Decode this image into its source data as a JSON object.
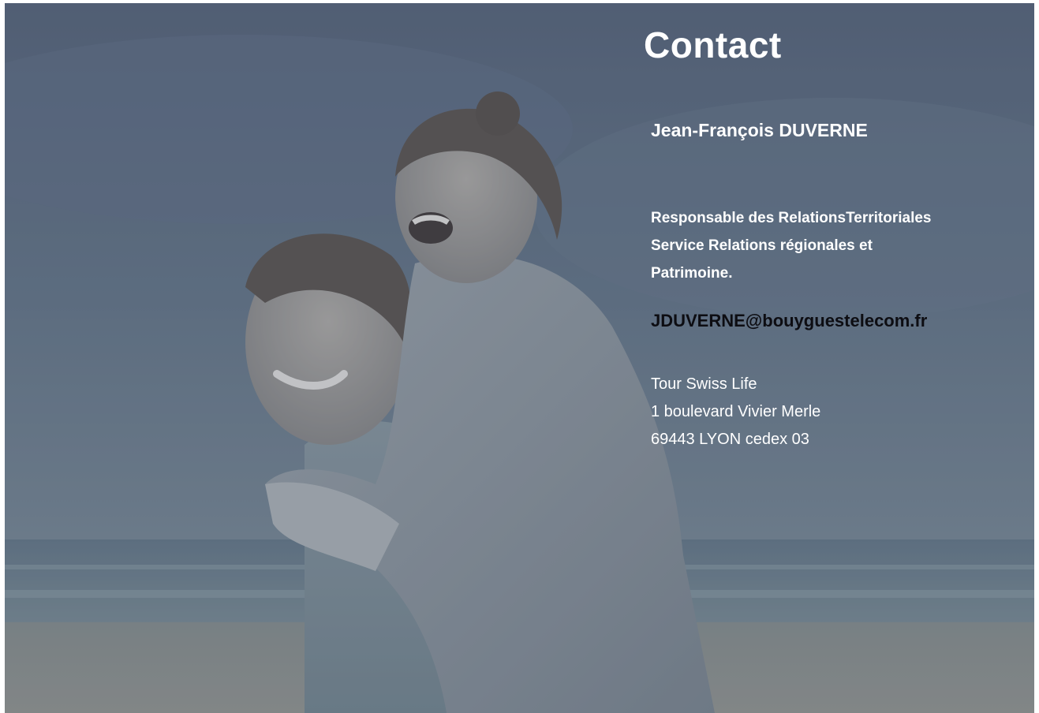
{
  "contact": {
    "title": "Contact",
    "name": "Jean-François DUVERNE",
    "role_lines": [
      "Responsable des RelationsTerritoriales",
      "Service Relations régionales et",
      "Patrimoine."
    ],
    "email": "JDUVERNE@bouyguestelecom.fr",
    "address_lines": [
      "Tour Swiss Life",
      "1 boulevard Vivier Merle",
      "69443 LYON cedex 03"
    ]
  },
  "colors": {
    "sky": "#5e6b7c",
    "sea": "#6f8290",
    "sand": "#8e9090",
    "coat": "#8f979f",
    "text": "#ffffff",
    "email": "#0d0d12"
  }
}
